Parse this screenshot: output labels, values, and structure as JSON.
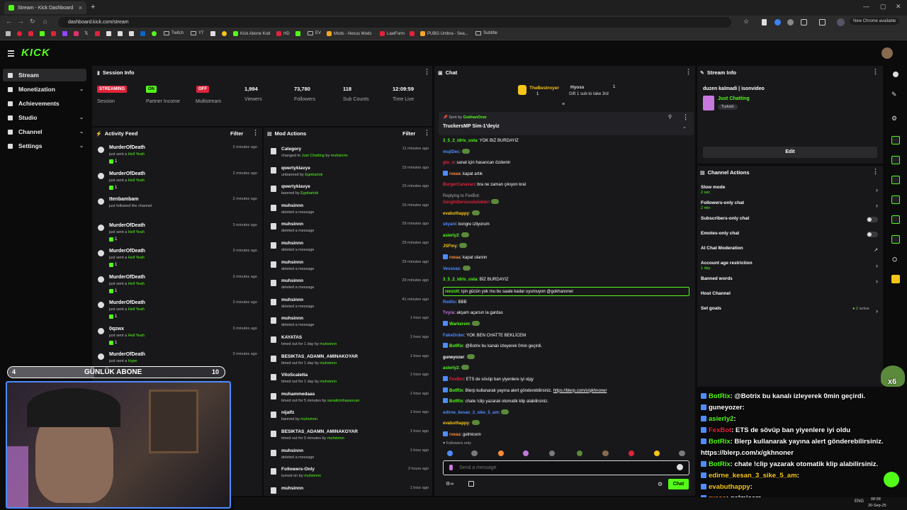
{
  "browser": {
    "tab_title": "Stream - Kick Dashboard",
    "new_tab": "+",
    "url": "dashboard.kick.com/stream",
    "chrome_notice": "New Chrome available",
    "bookmarks": [
      "Twitch",
      "YT",
      "Kick Abone Kod",
      "HD",
      "EV",
      "Mods - Nexus Mods",
      "LawForm",
      "PUBG Umbra - Sea...",
      "Subtitle"
    ]
  },
  "app": {
    "logo": "KICK"
  },
  "sidebar": {
    "items": [
      {
        "label": "Stream",
        "icon": "video-icon"
      },
      {
        "label": "Monetization",
        "icon": "dollar-icon"
      },
      {
        "label": "Achievements",
        "icon": "trophy-icon"
      },
      {
        "label": "Studio",
        "icon": "studio-icon"
      },
      {
        "label": "Channel",
        "icon": "channel-icon"
      },
      {
        "label": "Settings",
        "icon": "gear-icon"
      }
    ]
  },
  "session": {
    "title": "Session Info",
    "stats": [
      {
        "badge": "STREAMING",
        "label": "Session",
        "color": "#e0233a"
      },
      {
        "badge": "ON",
        "label": "Partner Income",
        "color": "#53fc18"
      },
      {
        "badge": "OFF",
        "label": "Multistream",
        "color": "#e0233a"
      },
      {
        "value": "1,994",
        "label": "Viewers"
      },
      {
        "value": "73,780",
        "label": "Followers"
      },
      {
        "value": "118",
        "label": "Sub Counts"
      },
      {
        "value": "12:09:59",
        "label": "Time Live"
      }
    ]
  },
  "activity": {
    "title": "Activity Feed",
    "filter": "Filter",
    "items": [
      {
        "name": "MurderOfDeath",
        "pre": "just sent a ",
        "hl": "Hell Yeah",
        "amount": "1",
        "time": "2 minutes ago"
      },
      {
        "name": "MurderOfDeath",
        "pre": "just sent a ",
        "hl": "Hell Yeah",
        "amount": "1",
        "time": "2 minutes ago"
      },
      {
        "name": "ttenbambam",
        "pre": "just followed the channel",
        "hl": "",
        "amount": "",
        "time": "2 minutes ago"
      },
      {
        "name": "MurderOfDeath",
        "pre": "just sent a ",
        "hl": "Hell Yeah",
        "amount": "1",
        "time": "3 minutes ago"
      },
      {
        "name": "MurderOfDeath",
        "pre": "just sent a ",
        "hl": "Hell Yeah",
        "amount": "1",
        "time": "3 minutes ago"
      },
      {
        "name": "MurderOfDeath",
        "pre": "just sent a ",
        "hl": "Hell Yeah",
        "amount": "1",
        "time": "3 minutes ago"
      },
      {
        "name": "MurderOfDeath",
        "pre": "just sent a ",
        "hl": "Hell Yeah",
        "amount": "1",
        "time": "3 minutes ago"
      },
      {
        "name": "0qzwx",
        "pre": "just sent a ",
        "hl": "Hell Yeah",
        "amount": "1",
        "time": "3 minutes ago"
      },
      {
        "name": "MurderOfDeath",
        "pre": "just sent a ",
        "hl": "Hype",
        "amount": "",
        "time": "3 minutes ago"
      }
    ]
  },
  "mod": {
    "title": "Mod Actions",
    "filter": "Filter",
    "items": [
      {
        "name": "Category",
        "pre": "changed to ",
        "hl": "Just Chatting",
        "mid": " by ",
        "hl2": "muhsinnn",
        "time": "11 minutes ago"
      },
      {
        "name": "qwertyklavye",
        "pre": "unbanned by ",
        "hl": "Egebartok",
        "mid": "",
        "hl2": "",
        "time": "15 minutes ago"
      },
      {
        "name": "qwertyklavye",
        "pre": "banned by ",
        "hl": "Egebartok",
        "mid": "",
        "hl2": "",
        "time": "15 minutes ago"
      },
      {
        "name": "muhsinnn",
        "pre": "deleted a message",
        "hl": "",
        "mid": "",
        "hl2": "",
        "time": "16 minutes ago"
      },
      {
        "name": "muhsinnn",
        "pre": "deleted a message",
        "hl": "",
        "mid": "",
        "hl2": "",
        "time": "29 minutes ago"
      },
      {
        "name": "muhsinnn",
        "pre": "deleted a message",
        "hl": "",
        "mid": "",
        "hl2": "",
        "time": "29 minutes ago"
      },
      {
        "name": "muhsinnn",
        "pre": "deleted a message",
        "hl": "",
        "mid": "",
        "hl2": "",
        "time": "29 minutes ago"
      },
      {
        "name": "muhsinnn",
        "pre": "deleted a message",
        "hl": "",
        "mid": "",
        "hl2": "",
        "time": "29 minutes ago"
      },
      {
        "name": "muhsinnn",
        "pre": "deleted a message",
        "hl": "",
        "mid": "",
        "hl2": "",
        "time": "41 minutes ago"
      },
      {
        "name": "muhsinnn",
        "pre": "deleted a message",
        "hl": "",
        "mid": "",
        "hl2": "",
        "time": "1 hour ago"
      },
      {
        "name": "KAYATAS",
        "pre": "timed out for 1 day by ",
        "hl": "muhsinnn",
        "mid": "",
        "hl2": "",
        "time": "1 hour ago"
      },
      {
        "name": "BESIKTAS_ADAMN_AMINAKOYAR",
        "pre": "timed out for 1 day by ",
        "hl": "muhsinnn",
        "mid": "",
        "hl2": "",
        "time": "1 hour ago"
      },
      {
        "name": "VitoScaletta",
        "pre": "timed out for 1 day by ",
        "hl": "muhsinnn",
        "mid": "",
        "hl2": "",
        "time": "1 hour ago"
      },
      {
        "name": "muhammedaas",
        "pre": "timed out for 5 minutes by ",
        "hl": "sanaticinhasancan",
        "mid": "",
        "hl2": "",
        "time": "1 hour ago"
      },
      {
        "name": "nijalfz",
        "pre": "banned by ",
        "hl": "muhsinnn",
        "mid": "",
        "hl2": "",
        "time": "1 hour ago"
      },
      {
        "name": "BESIKTAS_ADAMN_AMINAKOYAR",
        "pre": "timed out for 5 minutes by ",
        "hl": "muhsinnn",
        "mid": "",
        "hl2": "",
        "time": "1 hour ago"
      },
      {
        "name": "muhsinnn",
        "pre": "deleted a message",
        "hl": "",
        "mid": "",
        "hl2": "",
        "time": "1 hour ago"
      },
      {
        "name": "Followers-Only",
        "pre": "turned on by ",
        "hl": "muhsinnn",
        "mid": "",
        "hl2": "",
        "time": "2 hours ago"
      },
      {
        "name": "muhsinnn",
        "pre": "",
        "hl": "",
        "mid": "",
        "hl2": "",
        "time": "1 hour ago"
      }
    ]
  },
  "chat": {
    "title": "Chat",
    "top_gifter": "TheBestroyer",
    "top_gifter_count": "1",
    "gift_user": "Hyoss",
    "gift_count": "1",
    "gift_text": "Gift 1 sub to take 3rd",
    "pinned_by": "Sent by",
    "pinned_user": "GokhanOner",
    "pinned_text": "TruckersMP Sim-1'deyiz",
    "messages": [
      {
        "user": "3_5_2_idris_usta",
        "color": "#53fc18",
        "text": ": YOK BIZ BURDAYIZ"
      },
      {
        "user": "mujiDec",
        "color": "#4f8cff",
        "text": ":",
        "emote": true
      },
      {
        "user": "gta_n",
        "color": "#e0233a",
        "text": ": sanat için hasancan özdemir"
      },
      {
        "user": "rxeaa",
        "color": "#ff8a3a",
        "text": ": kapat artık",
        "badges": true
      },
      {
        "user": "BurgerCanavarı",
        "color": "#e0233a",
        "text": ": bra ne zaman çıkıyon kral"
      },
      {
        "user": "GerginDeruscolulukler",
        "color": "#e0233a",
        "text": ":",
        "emote": true,
        "reply": "Replying to FexBot:"
      },
      {
        "user": "evabuthappy",
        "color": "#f5c518",
        "text": ":",
        "emote": true
      },
      {
        "user": "skyani",
        "color": "#4f8cff",
        "text": ": kongre izliyorum"
      },
      {
        "user": "asierly2",
        "color": "#53fc18",
        "text": ":",
        "emote": true
      },
      {
        "user": "JSFmy",
        "color": "#f5c518",
        "text": ":",
        "emote": true
      },
      {
        "user": "rxeaa",
        "color": "#ff8a3a",
        "text": ": kapat ulannn",
        "badges": true
      },
      {
        "user": "Vessnas",
        "color": "#4f8cff",
        "text": ":",
        "emote": true
      },
      {
        "user": "3_5_2_idris_usta",
        "color": "#53fc18",
        "text": ": BİZ BURDAYIZ"
      },
      {
        "user": "renzolt",
        "color": "#53fc18",
        "text": ": işin gücün yok mu bu saate kadar uyumuyon @gokhanoner",
        "highlight": true
      },
      {
        "user": "Redtix",
        "color": "#4f8cff",
        "text": ": BBB"
      },
      {
        "user": "Tvyra",
        "color": "#c678dd",
        "text": ": akşam açarsın la gardas"
      },
      {
        "user": "Warkerem",
        "color": "#53fc18",
        "text": ":",
        "emote": true,
        "badges": true
      },
      {
        "user": "FakeOrder",
        "color": "#4f8cff",
        "text": ": YOK BEN CHATTE BEKLİCEM"
      },
      {
        "user": "BotRix",
        "color": "#53fc18",
        "text": ": @Botrix bu kanalı izleyerek 0min geçirdi.",
        "badges": true
      },
      {
        "user": "guneyozer",
        "color": "#ffffff",
        "text": ":",
        "emote": true
      },
      {
        "user": "asierly2",
        "color": "#53fc18",
        "text": ":",
        "emote": true
      },
      {
        "user": "FexBot",
        "color": "#e0233a",
        "text": ": ETS de sövüp ban yiyenlere iyi olду",
        "badges": true
      },
      {
        "user": "BotRix",
        "color": "#53fc18",
        "text": ": Blerp kullanarak yayına alert gönderebilirsiniz. ",
        "link": "https://blerp.com/x/gkhnoner",
        "badges": true
      },
      {
        "user": "BotRix",
        "color": "#53fc18",
        "text": ": chate !clip yazarak otomatik klip alabilirsiniz.",
        "badges": true
      },
      {
        "user": "edirne_kesan_3_sike_5_am",
        "color": "#4f8cff",
        "text": ":",
        "emote": true
      },
      {
        "user": "evabuthappy",
        "color": "#f5c518",
        "text": ":",
        "emote": true
      },
      {
        "user": "rxeaa",
        "color": "#ff8a3a",
        "text": ": gelmicem",
        "badges": true
      }
    ],
    "followers_only": "Followers only",
    "placeholder": "Send a message",
    "send": "Chat"
  },
  "stream_info": {
    "title": "Stream Info",
    "stream_title": "duzen kalmadi | isonvideo",
    "category": "Just Chatting",
    "tag": "Turkish",
    "edit": "Edit"
  },
  "channel_actions": {
    "title": "Channel Actions",
    "items": [
      {
        "label": "Slow mode",
        "sub": "2 sec",
        "control": "chevron"
      },
      {
        "label": "Followers-only chat",
        "sub": "2 min",
        "control": "chevron"
      },
      {
        "label": "Subscribers-only chat",
        "sub": "",
        "control": "toggle"
      },
      {
        "label": "Emotes-only chat",
        "sub": "",
        "control": "toggle"
      },
      {
        "label": "AI Chat Moderation",
        "sub": "",
        "control": "external"
      },
      {
        "label": "Account age restriction",
        "sub": "1 day",
        "control": "chevron"
      },
      {
        "label": "Banned words",
        "sub": "",
        "control": "chevron"
      },
      {
        "label": "Host Channel",
        "sub": "",
        "control": "none"
      },
      {
        "label": "Set goals",
        "sub": "",
        "control": "chevron",
        "extra": "2 active"
      }
    ]
  },
  "overlay": {
    "sub_goal_current": "4",
    "sub_goal_label": "GÜNLÜK ABONE",
    "sub_goal_target": "10",
    "multiplier": "x6",
    "chat": [
      {
        "user": "BotRix",
        "color": "#53fc18",
        "text": ": @Botrix bu kanalı izleyerek 0min geçirdi."
      },
      {
        "user": "guneyozer",
        "color": "#ffffff",
        "text": ":"
      },
      {
        "user": "asierly2",
        "color": "#53fc18",
        "text": ":"
      },
      {
        "user": "FexBot",
        "color": "#e0233a",
        "text": ": ETS de sövüp ban yiyenlere iyi oldu"
      },
      {
        "user": "BotRix",
        "color": "#53fc18",
        "text": ": Blerp kullanarak yayına alert gönderebilirsiniz."
      },
      {
        "user": "",
        "color": "#ffffff",
        "text": "https://blerp.com/x/gkhnoner"
      },
      {
        "user": "BotRix",
        "color": "#53fc18",
        "text": ": chate !clip yazarak otomatik klip alabilirsiniz."
      },
      {
        "user": "edirne_kesan_3_sike_5_am",
        "color": "#f5c518",
        "text": ":"
      },
      {
        "user": "evabuthappy",
        "color": "#f5c518",
        "text": ":"
      },
      {
        "user": "rxeaa",
        "color": "#ff8a3a",
        "text": ": gelmicem"
      }
    ]
  },
  "taskbar": {
    "lang": "ENG",
    "time": "08:58",
    "date": "20-Sep-25"
  },
  "colors": {
    "accent": "#53fc18",
    "panel": "#18181b",
    "bg": "#0b0b0c",
    "danger": "#e0233a"
  }
}
